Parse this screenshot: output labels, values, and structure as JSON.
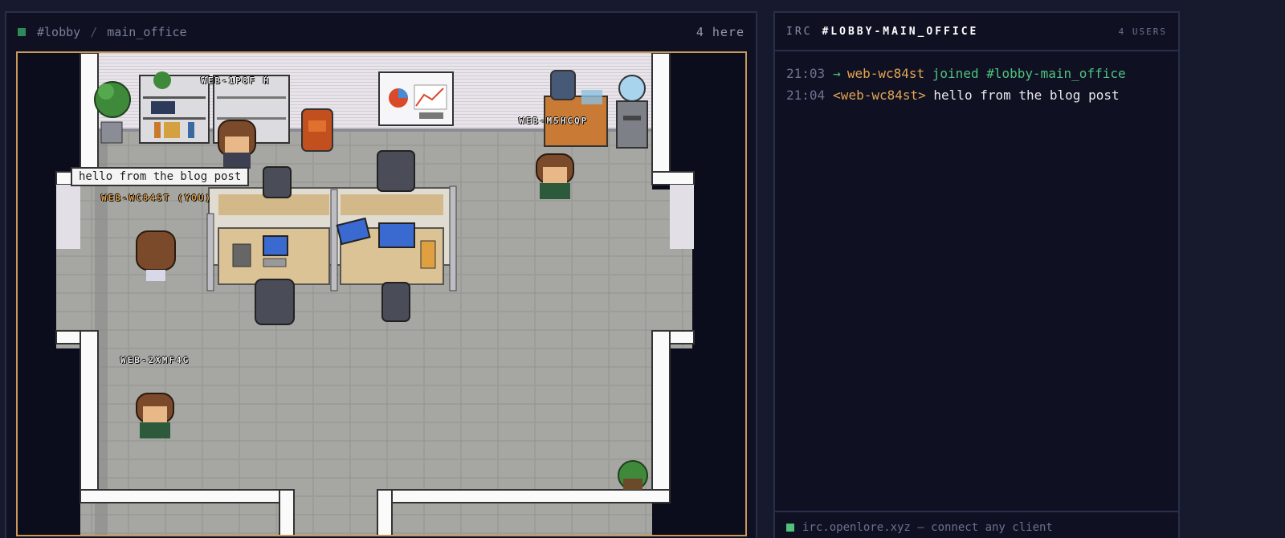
{
  "game": {
    "channel": "#lobby",
    "separator": "/",
    "room": "main_office",
    "here_count": "4 here",
    "speech_bubble": "hello from the blog post",
    "players": [
      {
        "label": "WEB-1P8F H",
        "you": false
      },
      {
        "label": "WEB-WC84ST (YOU)",
        "you": true
      },
      {
        "label": "WEB-M5HCQP",
        "you": false
      },
      {
        "label": "WEB-2XMF4G",
        "you": false
      }
    ]
  },
  "irc": {
    "tag": "IRC",
    "channel": "#LOBBY-MAIN_OFFICE",
    "users": "4 USERS",
    "messages": [
      {
        "time": "21:03",
        "arrow": "→",
        "nick": "web-wc84st",
        "text": "joined #lobby-main_office"
      },
      {
        "time": "21:04",
        "nick": "<web-wc84st>",
        "text": "hello from the blog post"
      }
    ],
    "footer": "irc.openlore.xyz — connect any client"
  },
  "colors": {
    "accent_border": "#c9995a",
    "nick": "#e3a552",
    "status": "#4fc27e"
  }
}
